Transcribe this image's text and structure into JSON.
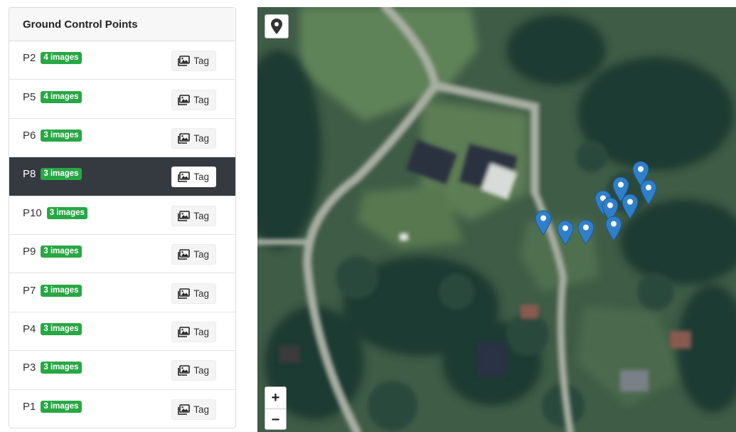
{
  "panel": {
    "title": "Ground Control Points",
    "items": [
      {
        "name": "P2",
        "badge": "4 images",
        "action": "Tag",
        "active": false
      },
      {
        "name": "P5",
        "badge": "4 images",
        "action": "Tag",
        "active": false
      },
      {
        "name": "P6",
        "badge": "3 images",
        "action": "Tag",
        "active": false
      },
      {
        "name": "P8",
        "badge": "3 images",
        "action": "Tag",
        "active": true
      },
      {
        "name": "P10",
        "badge": "3 images",
        "action": "Tag",
        "active": false
      },
      {
        "name": "P9",
        "badge": "3 images",
        "action": "Tag",
        "active": false
      },
      {
        "name": "P7",
        "badge": "3 images",
        "action": "Tag",
        "active": false
      },
      {
        "name": "P4",
        "badge": "3 images",
        "action": "Tag",
        "active": false
      },
      {
        "name": "P3",
        "badge": "3 images",
        "action": "Tag",
        "active": false
      },
      {
        "name": "P1",
        "badge": "3 images",
        "action": "Tag",
        "active": false
      }
    ]
  },
  "map": {
    "zoom_in_label": "+",
    "zoom_out_label": "−",
    "locate_icon": "map-marker-icon",
    "marker_count": 10,
    "colors": {
      "marker": "#2f7fc9",
      "active_row": "#343a40",
      "badge": "#28a745"
    }
  }
}
